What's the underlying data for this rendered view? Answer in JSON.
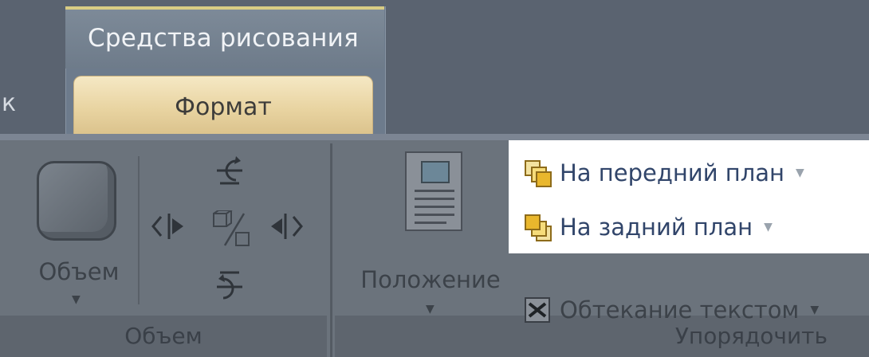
{
  "tabs": {
    "contextual_group_label": "Средства рисования",
    "left_partial_tab": "к",
    "active_tab": "Формат"
  },
  "groups": {
    "volume": {
      "footer_label": "Объем",
      "button_label": "Объем"
    },
    "arrange": {
      "footer_label": "Упорядочить",
      "position_label": "Положение",
      "commands": {
        "bring_forward": "На передний план",
        "send_backward": "На задний план",
        "text_wrap": "Обтекание текстом"
      }
    }
  },
  "icons": {
    "tilt_up": "tilt-up-icon",
    "tilt_down": "tilt-down-icon",
    "tilt_left": "tilt-left-icon",
    "tilt_right": "tilt-right-icon",
    "toggle_3d": "toggle-3d-icon",
    "dropdown": "chevron-down-icon"
  },
  "colors": {
    "active_tab": "#f5e8c4",
    "ribbon_bg": "#6b737c",
    "highlight": "#ffffff",
    "context_accent": "#d8cc84"
  }
}
